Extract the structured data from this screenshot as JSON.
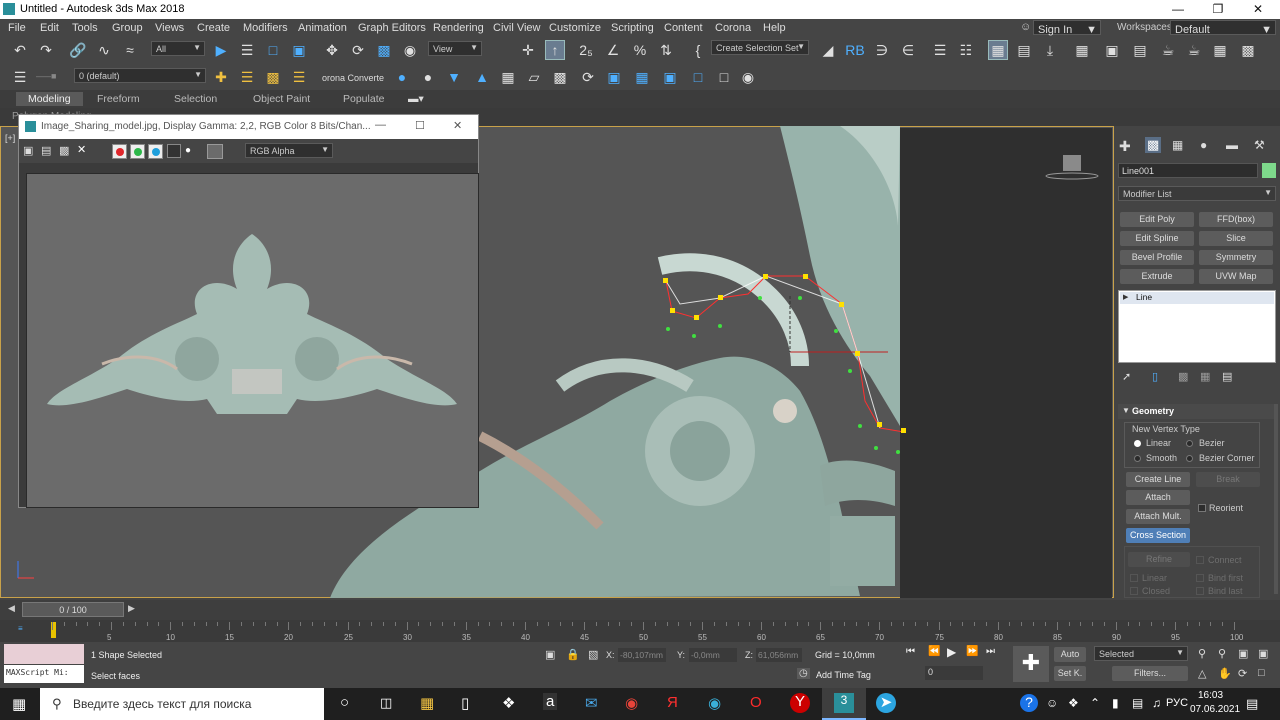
{
  "app": {
    "title": "Untitled - Autodesk 3ds Max 2018",
    "sign_in": "Sign In",
    "workspaces_label": "Workspaces:",
    "workspace": "Default"
  },
  "menu": [
    "File",
    "Edit",
    "Tools",
    "Group",
    "Views",
    "Create",
    "Modifiers",
    "Animation",
    "Graph Editors",
    "Rendering",
    "Civil View",
    "Customize",
    "Scripting",
    "Content",
    "Corona",
    "Help"
  ],
  "toolbar": {
    "filter": "All",
    "view": "View",
    "selection_set": "Create Selection Set",
    "layer": "0 (default)",
    "corona_converter": "orona Converte"
  },
  "ribbon": {
    "tabs": [
      "Modeling",
      "Freeform",
      "Selection",
      "Object Paint",
      "Populate"
    ],
    "sub": "Polygon Modeling"
  },
  "viewport": {
    "label": "[+]"
  },
  "image_window": {
    "title": "Image_Sharing_model.jpg, Display Gamma: 2,2, RGB Color 8 Bits/Chan...",
    "channel": "RGB Alpha",
    "colors": [
      "#e0262b",
      "#2db84a",
      "#1e9fdc"
    ]
  },
  "command_panel": {
    "object_name": "Line001",
    "object_color": "#7ed98b",
    "modifier_list": "Modifier List",
    "modifier_buttons": [
      "Edit Poly",
      "FFD(box)",
      "Edit Spline",
      "Slice",
      "Bevel Profile",
      "Symmetry",
      "Extrude",
      "UVW Map"
    ],
    "stack_item": "Line",
    "rollout": "Geometry",
    "new_vertex_type": "New Vertex Type",
    "vertex_types": [
      "Linear",
      "Bezier",
      "Smooth",
      "Bezier Corner"
    ],
    "buttons": {
      "create_line": "Create Line",
      "break": "Break",
      "attach": "Attach",
      "reorient": "Reorient",
      "attach_mult": "Attach Mult.",
      "cross_section": "Cross Section",
      "refine": "Refine",
      "connect": "Connect",
      "linear": "Linear",
      "bind_first": "Bind first",
      "closed": "Closed",
      "bind_last": "Bind last"
    }
  },
  "timeline": {
    "slider": "0 / 100",
    "ticks": [
      "0",
      "5",
      "10",
      "15",
      "20",
      "25",
      "30",
      "35",
      "40",
      "45",
      "50",
      "55",
      "60",
      "65",
      "70",
      "75",
      "80",
      "85",
      "90",
      "95",
      "100"
    ]
  },
  "status": {
    "maxscript": "MAXScript Mi:",
    "line1": "1 Shape Selected",
    "line2": "Select faces",
    "x_label": "X:",
    "x": "-80,107mm",
    "y_label": "Y:",
    "y": "-0,0mm",
    "z_label": "Z:",
    "z": "61,056mm",
    "grid": "Grid = 10,0mm",
    "add_time_tag": "Add Time Tag",
    "auto": "Auto",
    "setk": "Set K.",
    "selected": "Selected",
    "filters": "Filters...",
    "frame": "0"
  },
  "taskbar": {
    "search_placeholder": "Введите здесь текст для поиска",
    "lang": "РУС",
    "time": "16:03",
    "date": "07.06.2021"
  }
}
